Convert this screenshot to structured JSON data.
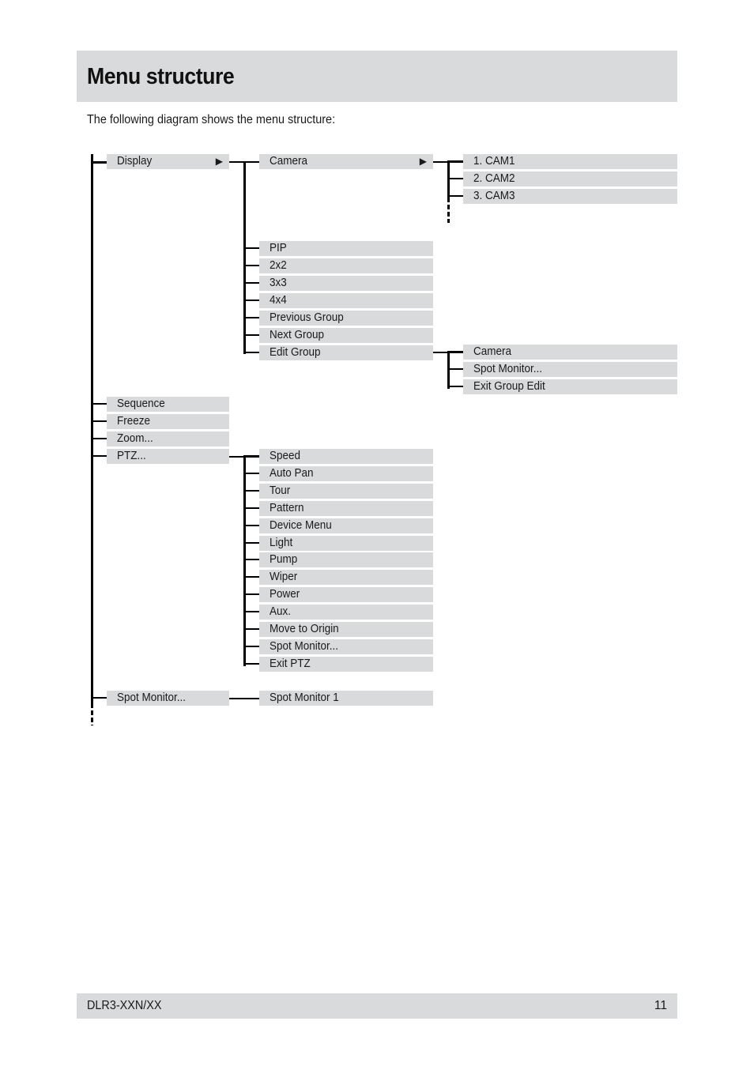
{
  "header": {
    "title": "Menu structure"
  },
  "intro": "The following diagram shows the menu structure:",
  "menu": {
    "display": {
      "label": "Display",
      "arrow": "▶"
    },
    "camera": {
      "label": "Camera",
      "arrow": "▶"
    },
    "cameras": [
      "1. CAM1",
      "2. CAM2",
      "3. CAM3"
    ],
    "display_items": [
      "PIP",
      "2x2",
      "3x3",
      "4x4",
      "Previous Group",
      "Next Group",
      "Edit Group"
    ],
    "edit_group_items": [
      "Camera",
      "Spot Monitor...",
      "Exit Group Edit"
    ],
    "root_items": [
      "Sequence",
      "Freeze",
      "Zoom...",
      "PTZ..."
    ],
    "ptz_items": [
      "Speed",
      "Auto Pan",
      "Tour",
      "Pattern",
      "Device Menu",
      "Light",
      "Pump",
      "Wiper",
      "Power",
      "Aux.",
      "Move to Origin",
      "Spot Monitor...",
      "Exit PTZ"
    ],
    "spot_monitor": {
      "label": "Spot Monitor..."
    },
    "spot_monitor_items": [
      "Spot Monitor 1"
    ]
  },
  "footer": {
    "model": "DLR3-XXN/XX",
    "page": "11"
  }
}
